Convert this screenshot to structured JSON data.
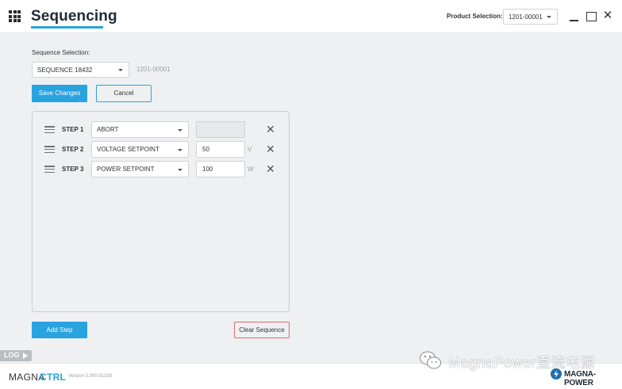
{
  "header": {
    "title": "Sequencing",
    "product_selection_label": "Product Selection:",
    "product_selection_value": "1201-00001"
  },
  "sequence": {
    "label": "Sequence Selection:",
    "selected": "SEQUENCE 18432",
    "product_id": "1201-00001"
  },
  "actions": {
    "save_label": "Save Changes",
    "cancel_label": "Cancel",
    "add_step_label": "Add Step",
    "clear_sequence_label": "Clear Sequence"
  },
  "steps": [
    {
      "label": "STEP 1",
      "command": "ABORT",
      "value": "",
      "unit": "",
      "disabled": true
    },
    {
      "label": "STEP 2",
      "command": "VOLTAGE SETPOINT",
      "value": "50",
      "unit": "V",
      "disabled": false
    },
    {
      "label": "STEP 3",
      "command": "POWER SETPOINT",
      "value": "100",
      "unit": "W",
      "disabled": false
    }
  ],
  "log_label": "LOG",
  "footer": {
    "brand_part1": "MAGNA",
    "brand_part2": "CTRL",
    "version": "Version 0.000-51026",
    "company_logo_text": "MAGNA-POWER"
  },
  "watermark": {
    "text": "MagnaPower直流电源"
  },
  "colors": {
    "accent": "#29a3da",
    "danger_border": "#e06b6b",
    "background": "#eef0f2"
  },
  "icons": {
    "apps": "apps-grid-icon",
    "drag": "drag-handle-icon",
    "remove": "close-icon",
    "log": "play-icon"
  }
}
